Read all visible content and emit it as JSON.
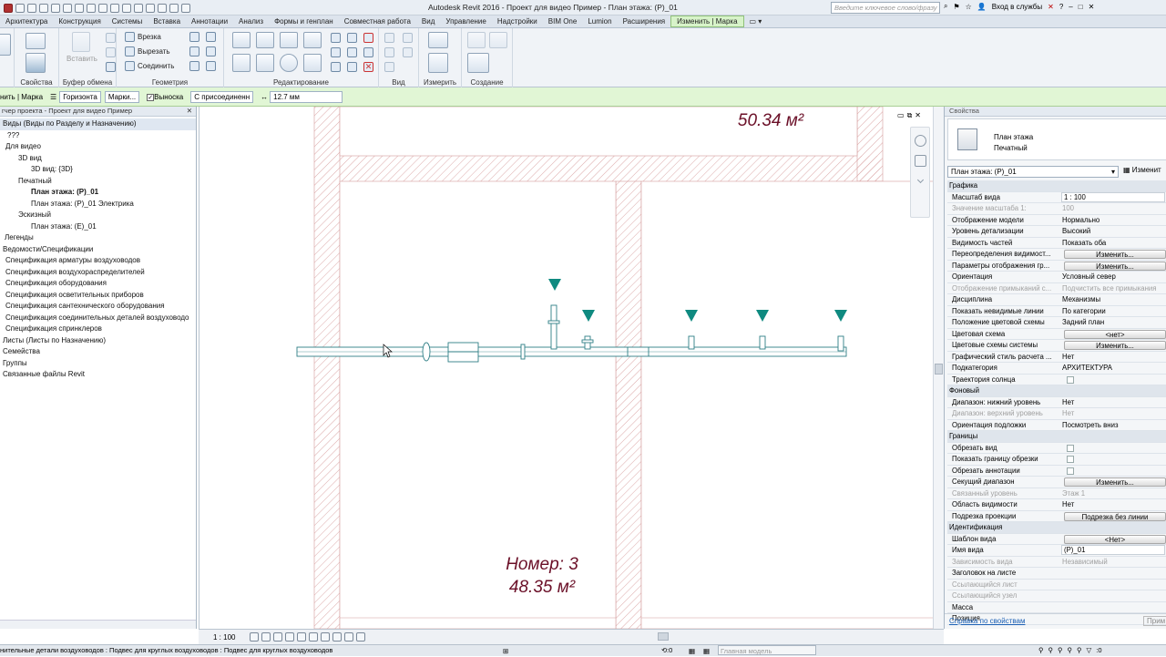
{
  "app": {
    "title": "Autodesk Revit 2016 -    Проект для видео Пример - План этажа: (Р)_01",
    "search_placeholder": "Введите ключевое слово/фразу",
    "signin": "Вход в службы"
  },
  "tabs": [
    "Архитектура",
    "Конструкция",
    "Системы",
    "Вставка",
    "Аннотации",
    "Анализ",
    "Формы и генплан",
    "Совместная работа",
    "Вид",
    "Управление",
    "Надстройки",
    "BIM One",
    "Lumion",
    "Расширения",
    "Изменить | Марка"
  ],
  "ribbon": {
    "panels": [
      "Свойства",
      "Буфер обмена",
      "Геометрия",
      "Редактирование",
      "Вид",
      "Измерить",
      "Создание"
    ],
    "paste": "Вставить",
    "geometry": [
      "Врезка",
      "Вырезать",
      "Соединить"
    ]
  },
  "optbar": {
    "mode": "нить | Марка",
    "orientation": "Горизонта",
    "tags": "Марки...",
    "leader": "Выноска",
    "attach": "С присоединенн",
    "length": "12.7 мм"
  },
  "browser": {
    "header": "гчер проекта - Проект для видео Пример",
    "items": [
      {
        "t": "Виды (Виды по Разделу и Назначению)",
        "i": 3,
        "sel": true
      },
      {
        "t": "???",
        "i": 8
      },
      {
        "t": "Для видео",
        "i": 6
      },
      {
        "t": "3D вид",
        "i": 20
      },
      {
        "t": "3D вид: {3D}",
        "i": 34
      },
      {
        "t": "Печатный",
        "i": 20
      },
      {
        "t": "План этажа: (Р)_01",
        "i": 34,
        "b": true
      },
      {
        "t": "План этажа: (Р)_01 Электрика",
        "i": 34
      },
      {
        "t": "Эскизный",
        "i": 20
      },
      {
        "t": "План этажа: (Е)_01",
        "i": 34
      },
      {
        "t": "Легенды",
        "i": 5
      },
      {
        "t": "Ведомости/Спецификации",
        "i": 3
      },
      {
        "t": "Спецификация арматуры воздуховодов",
        "i": 6
      },
      {
        "t": "Спецификация воздухораспределителей",
        "i": 6
      },
      {
        "t": "Спецификация оборудования",
        "i": 6
      },
      {
        "t": "Спецификация осветительных приборов",
        "i": 6
      },
      {
        "t": "Спецификация сантехнического оборудования",
        "i": 6
      },
      {
        "t": "Спецификация соединительных деталей воздуховодо",
        "i": 6
      },
      {
        "t": "Спецификация спринклеров",
        "i": 6
      },
      {
        "t": "Листы (Листы по Назначению)",
        "i": 3
      },
      {
        "t": "Семейства",
        "i": 3
      },
      {
        "t": "Группы",
        "i": 3
      },
      {
        "t": "Связанные файлы Revit",
        "i": 3
      }
    ]
  },
  "canvas": {
    "area_top": "50.34 м²",
    "room_label": "Номер: 3",
    "room_area": "48.35 м²"
  },
  "props": {
    "header": "Свойства",
    "type_line1": "План этажа",
    "type_line2": "Печатный",
    "selector": "План этажа: (Р)_01",
    "edit_type": "Изменит",
    "rows": [
      {
        "k": "Графика",
        "sec": true
      },
      {
        "k": "Масштаб вида",
        "v": "1 : 100",
        "box": true
      },
      {
        "k": "Значение масштаба    1:",
        "v": "100",
        "dis": true
      },
      {
        "k": "Отображение модели",
        "v": "Нормально"
      },
      {
        "k": "Уровень детализации",
        "v": "Высокий"
      },
      {
        "k": "Видимость частей",
        "v": "Показать оба"
      },
      {
        "k": "Переопределения видимост...",
        "v": "Изменить...",
        "btn": true
      },
      {
        "k": "Параметры отображения гр...",
        "v": "Изменить...",
        "btn": true
      },
      {
        "k": "Ориентация",
        "v": "Условный север"
      },
      {
        "k": "Отображение примыканий с...",
        "v": "Подчистить все примыкания",
        "dis": true
      },
      {
        "k": "Дисциплина",
        "v": "Механизмы"
      },
      {
        "k": "Показать невидимые линии",
        "v": "По категории"
      },
      {
        "k": "Положение цветовой схемы",
        "v": "Задний план"
      },
      {
        "k": "Цветовая схема",
        "v": "<нет>",
        "btn": true
      },
      {
        "k": "Цветовые схемы системы",
        "v": "Изменить...",
        "btn": true
      },
      {
        "k": "Графический стиль расчета ...",
        "v": "Нет"
      },
      {
        "k": "Подкатегория",
        "v": "АРХИТЕКТУРА"
      },
      {
        "k": "Траектория солнца",
        "chk": true
      },
      {
        "k": "Фоновый",
        "sec": true
      },
      {
        "k": "Диапазон: нижний уровень",
        "v": "Нет"
      },
      {
        "k": "Диапазон: верхний уровень",
        "v": "Нет",
        "dis": true
      },
      {
        "k": "Ориентация подложки",
        "v": "Посмотреть вниз"
      },
      {
        "k": "Границы",
        "sec": true
      },
      {
        "k": "Обрезать вид",
        "chk": true
      },
      {
        "k": "Показать границу обрезки",
        "chk": true
      },
      {
        "k": "Обрезать аннотации",
        "chk": true
      },
      {
        "k": "Секущий диапазон",
        "v": "Изменить...",
        "btn": true
      },
      {
        "k": "Связанный уровень",
        "v": "Этаж 1",
        "dis": true
      },
      {
        "k": "Область видимости",
        "v": "Нет"
      },
      {
        "k": "Подрезка проекции",
        "v": "Подрезка без линии",
        "btn": true
      },
      {
        "k": "Идентификация",
        "sec": true
      },
      {
        "k": "Шаблон вида",
        "v": "<Нет>",
        "btn": true
      },
      {
        "k": "Имя вида",
        "v": "(Р)_01",
        "box": true
      },
      {
        "k": "Зависимость вида",
        "v": "Независимый",
        "dis": true
      },
      {
        "k": "Заголовок на листе",
        "v": ""
      },
      {
        "k": "Ссылающийся лист",
        "v": "",
        "dis": true
      },
      {
        "k": "Ссылающийся узел",
        "v": "",
        "dis": true
      },
      {
        "k": "Масса",
        "v": ""
      },
      {
        "k": "Позиция",
        "v": ""
      }
    ],
    "help_link": "Справка по свойствам",
    "apply": "Прим"
  },
  "viewbar": {
    "scale": "1 : 100"
  },
  "status": {
    "text": "нительные детали воздуховодов : Подвес для круглых воздуховодов : Подвес для круглых воздуховодов",
    "zero": ":0",
    "model": "Главная модель"
  },
  "colors": {
    "accent": "#d7f3c9",
    "tag": "#0f8a80",
    "duct": "#2f7f86",
    "wall": "#d9a3a3",
    "room_text": "#6b1028"
  }
}
